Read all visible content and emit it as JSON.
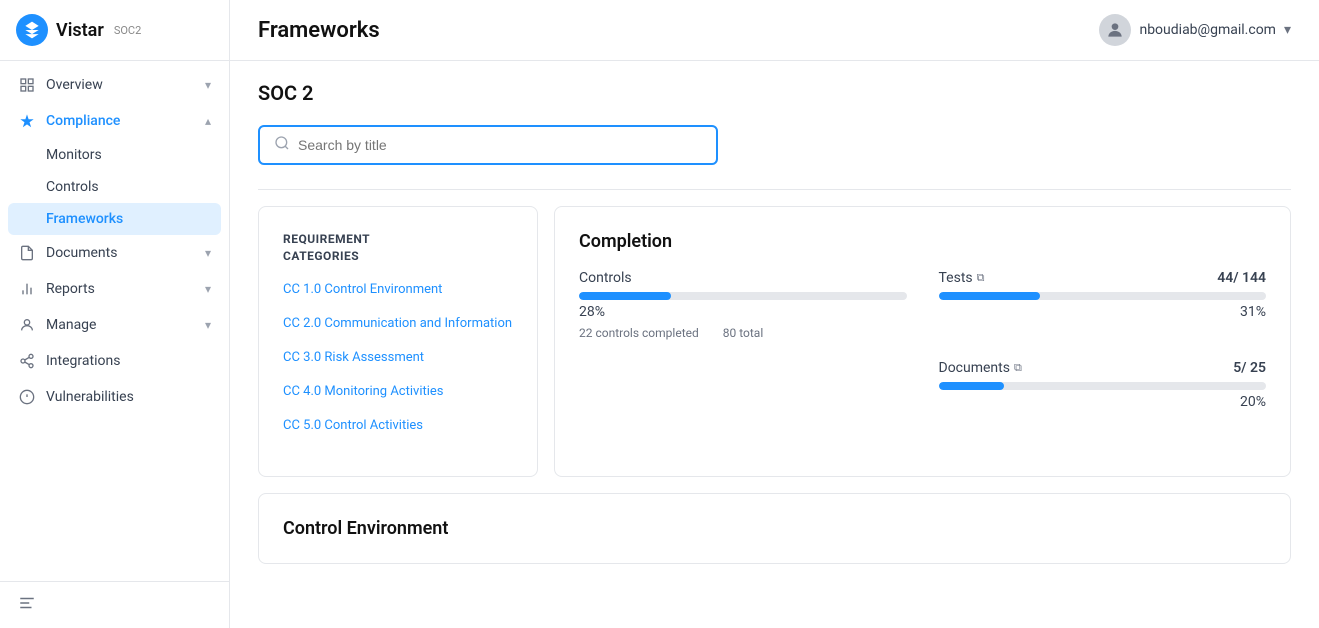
{
  "app": {
    "name": "Vistar",
    "badge": "SOC2"
  },
  "topbar": {
    "title": "Frameworks",
    "user_email": "nboudiab@gmail.com"
  },
  "sidebar": {
    "nav_items": [
      {
        "id": "overview",
        "label": "Overview",
        "has_chevron": true,
        "active": false
      },
      {
        "id": "compliance",
        "label": "Compliance",
        "has_chevron": true,
        "active": true
      },
      {
        "id": "documents",
        "label": "Documents",
        "has_chevron": true,
        "active": false
      },
      {
        "id": "reports",
        "label": "Reports",
        "has_chevron": true,
        "active": false
      },
      {
        "id": "manage",
        "label": "Manage",
        "has_chevron": true,
        "active": false
      },
      {
        "id": "integrations",
        "label": "Integrations",
        "has_chevron": false,
        "active": false
      },
      {
        "id": "vulnerabilities",
        "label": "Vulnerabilities",
        "has_chevron": false,
        "active": false
      }
    ],
    "compliance_sub": [
      {
        "id": "monitors",
        "label": "Monitors",
        "active": false
      },
      {
        "id": "controls",
        "label": "Controls",
        "active": false
      },
      {
        "id": "frameworks",
        "label": "Frameworks",
        "active": true
      }
    ]
  },
  "page": {
    "subtitle": "SOC 2",
    "search_placeholder": "Search by title"
  },
  "left_card": {
    "title": "REQUIREMENT\nCATEGORIES",
    "items": [
      "CC 1.0 Control Environment",
      "CC 2.0 Communication and Information",
      "CC 3.0 Risk Assessment",
      "CC 4.0 Monitoring Activities",
      "CC 5.0 Control Activities"
    ]
  },
  "right_card": {
    "completion_title": "Completion",
    "controls": {
      "label": "Controls",
      "progress_pct": 28,
      "progress_text": "28%",
      "completed": "22 controls completed",
      "total": "80 total"
    },
    "tests": {
      "label": "Tests",
      "value": "44/ 144",
      "progress_pct": 31,
      "progress_text": "31%"
    },
    "documents": {
      "label": "Documents",
      "value": "5/ 25",
      "progress_pct": 20,
      "progress_text": "20%"
    }
  },
  "bottom_card": {
    "title": "Control Environment"
  }
}
